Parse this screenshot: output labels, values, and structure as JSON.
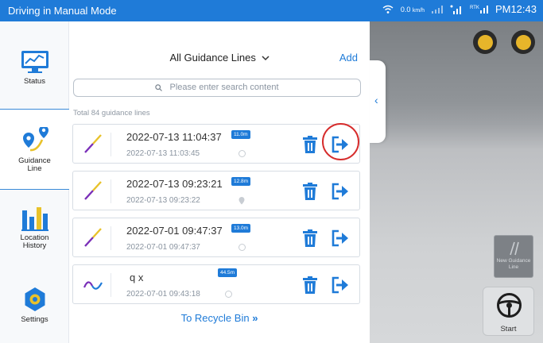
{
  "status_bar": {
    "title": "Driving in Manual Mode",
    "speed": "0.0",
    "speed_unit": "km/h",
    "rtk_label": "RTK",
    "time": "PM12:43"
  },
  "nav": {
    "items": [
      {
        "label": "Status",
        "icon": "monitor-chart-icon"
      },
      {
        "label": "Guidance Line",
        "icon": "guidance-line-icon"
      },
      {
        "label": "Location History",
        "icon": "bar-chart-icon"
      },
      {
        "label": "Settings",
        "icon": "gear-icon"
      }
    ],
    "active": "Guidance Line"
  },
  "panel": {
    "dropdown_label": "All Guidance Lines",
    "add_label": "Add",
    "search_placeholder": "Please enter search content",
    "total_text": "Total 84 guidance lines",
    "recycle_label": "To Recycle Bin",
    "items": [
      {
        "name": "2022-07-13 11:04:37",
        "date": "2022-07-13 11:03:45",
        "badge": "11.0m",
        "type": "straight"
      },
      {
        "name": "2022-07-13 09:23:21",
        "date": "2022-07-13 09:23:22",
        "badge": "12.8m",
        "type": "straight"
      },
      {
        "name": "2022-07-01 09:47:37",
        "date": "2022-07-01 09:47:37",
        "badge": "13.0m",
        "type": "straight"
      },
      {
        "name": "q x",
        "date": "2022-07-01 09:43:18",
        "badge": "44.5m",
        "type": "curve"
      }
    ]
  },
  "view": {
    "new_guidance_line_label": "New Guidance Line",
    "start_label": "Start"
  },
  "colors": {
    "accent": "#1f7bd8",
    "highlight": "#d62c2c",
    "line_purple": "#7a2fb8",
    "line_yellow": "#e8c22a"
  }
}
